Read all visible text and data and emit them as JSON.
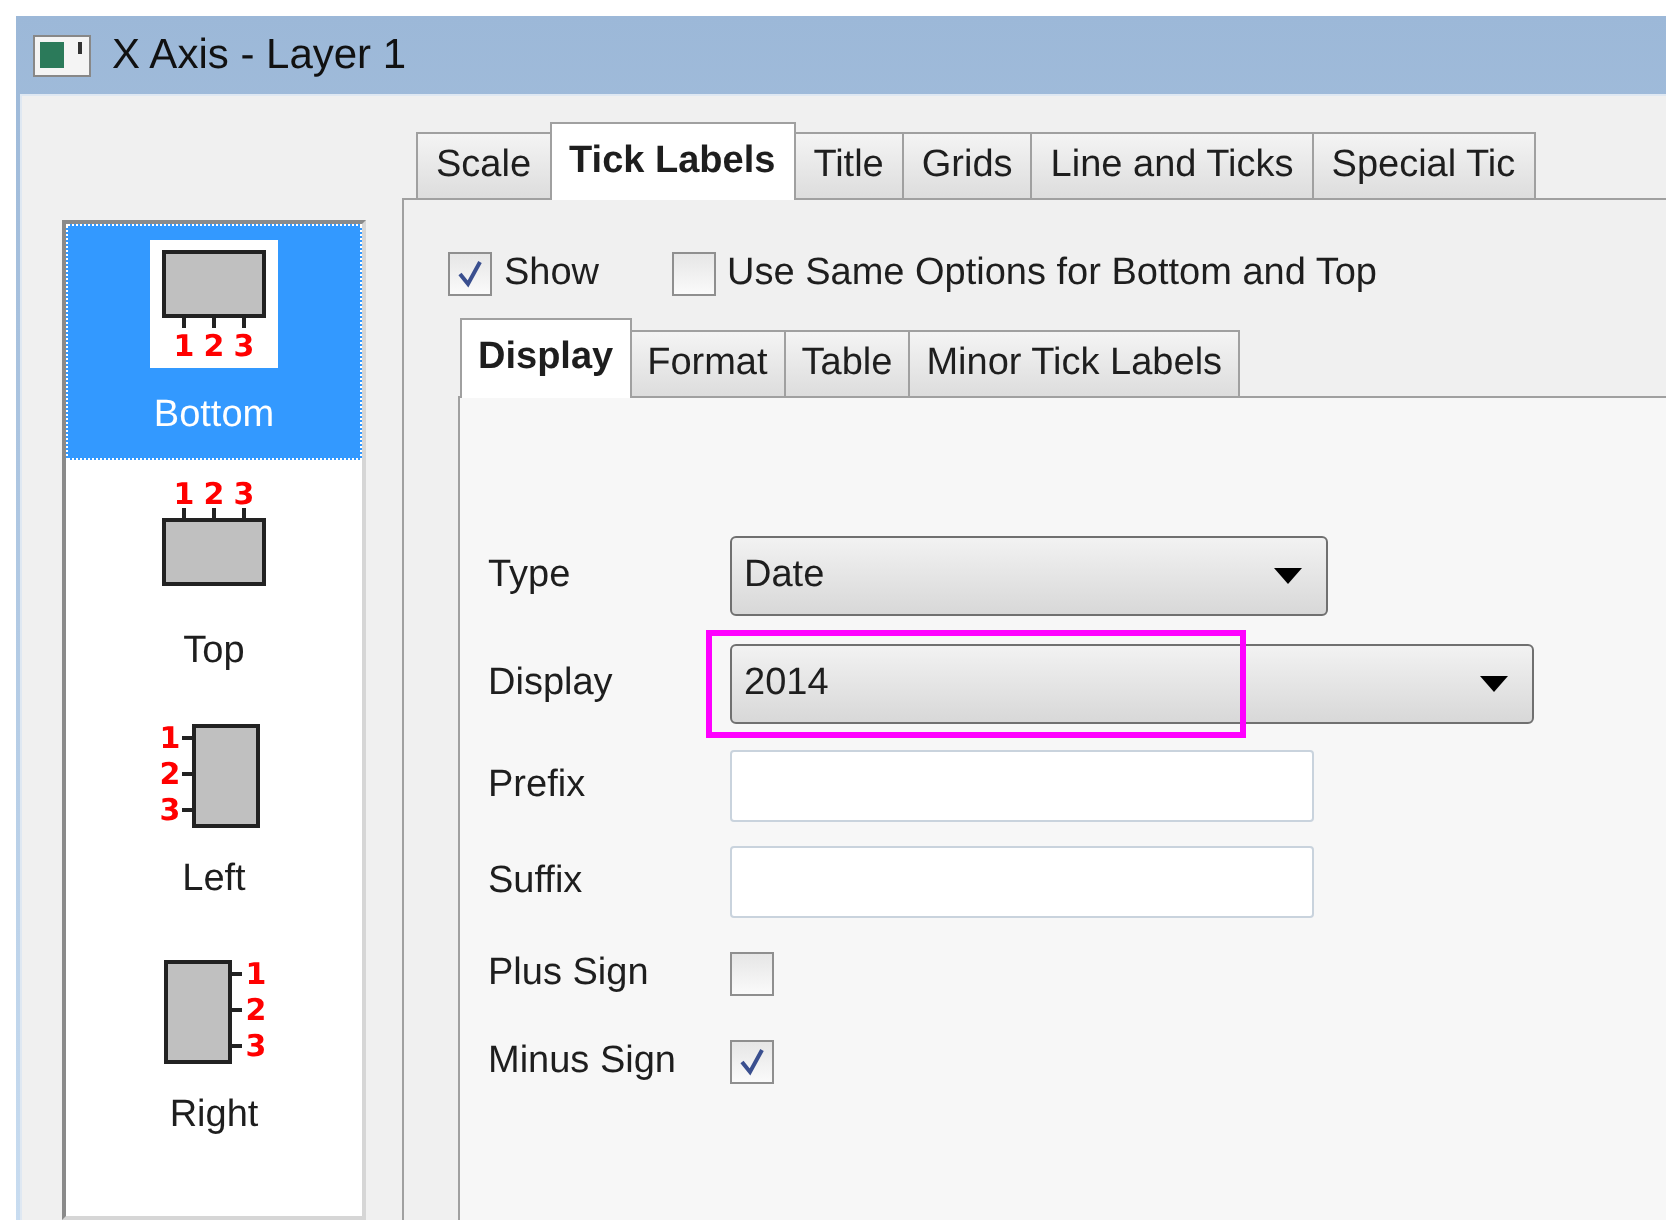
{
  "window": {
    "title": "X Axis - Layer 1"
  },
  "axes": [
    {
      "kind": "bottom",
      "label": "Bottom",
      "digits": [
        "1",
        "2",
        "3"
      ],
      "selected": true
    },
    {
      "kind": "top",
      "label": "Top",
      "digits": [
        "1",
        "2",
        "3"
      ],
      "selected": false
    },
    {
      "kind": "left",
      "label": "Left",
      "digits": [
        "1",
        "2",
        "3"
      ],
      "selected": false
    },
    {
      "kind": "right",
      "label": "Right",
      "digits": [
        "1",
        "2",
        "3"
      ],
      "selected": false
    }
  ],
  "tabs": [
    {
      "label": "Scale",
      "selected": false
    },
    {
      "label": "Tick Labels",
      "selected": true
    },
    {
      "label": "Title",
      "selected": false
    },
    {
      "label": "Grids",
      "selected": false
    },
    {
      "label": "Line and Ticks",
      "selected": false
    },
    {
      "label": "Special Tic",
      "selected": false
    }
  ],
  "options": [
    {
      "label": "Show",
      "checked": true
    },
    {
      "label": "Use Same Options for Bottom and Top",
      "checked": false
    }
  ],
  "subtabs": [
    {
      "label": "Display",
      "selected": true
    },
    {
      "label": "Format",
      "selected": false
    },
    {
      "label": "Table",
      "selected": false
    },
    {
      "label": "Minor Tick Labels",
      "selected": false
    }
  ],
  "fields": [
    {
      "kind": "dropdown",
      "label": "Type",
      "value": "Date",
      "wide": false
    },
    {
      "kind": "dropdown",
      "label": "Display",
      "value": "2014",
      "wide": true,
      "highlighted": true
    },
    {
      "kind": "text",
      "label": "Prefix"
    },
    {
      "kind": "text",
      "label": "Suffix"
    },
    {
      "kind": "checkbox",
      "label": "Plus Sign",
      "checked": false
    },
    {
      "kind": "checkbox",
      "label": "Minus Sign",
      "checked": true
    }
  ]
}
